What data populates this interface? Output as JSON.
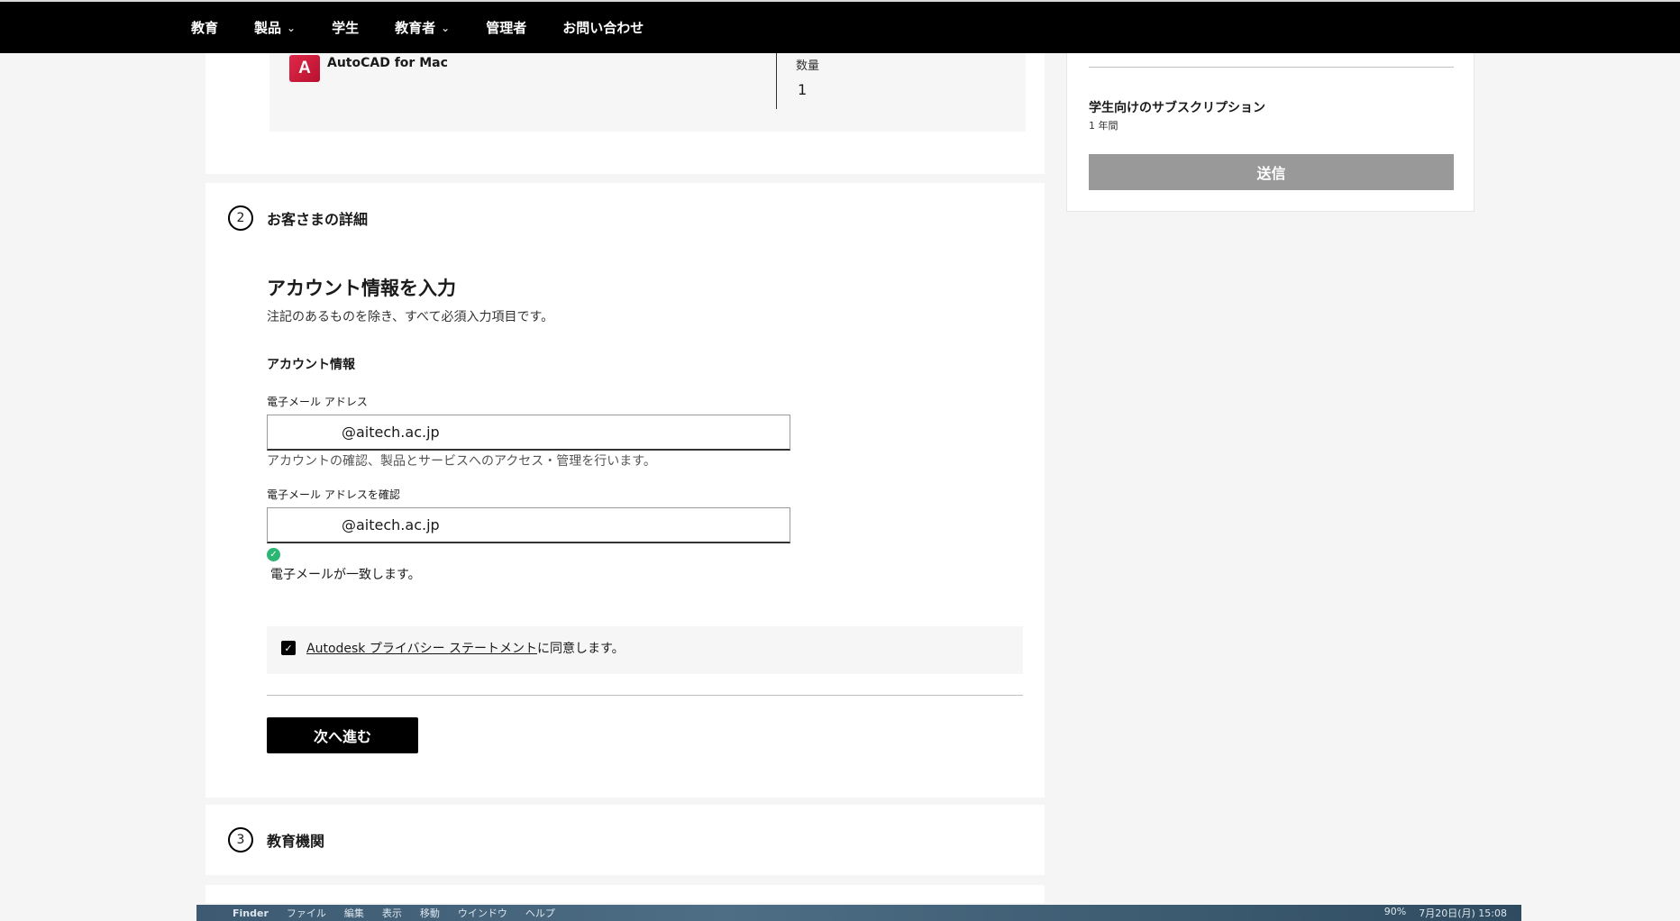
{
  "nav": {
    "items": [
      {
        "label": "教育",
        "has_dropdown": false
      },
      {
        "label": "製品",
        "has_dropdown": true
      },
      {
        "label": "学生",
        "has_dropdown": false
      },
      {
        "label": "教育者",
        "has_dropdown": true
      },
      {
        "label": "管理者",
        "has_dropdown": false
      },
      {
        "label": "お問い合わせ",
        "has_dropdown": false
      }
    ],
    "chevron": "⌄"
  },
  "product": {
    "logo_letter": "A",
    "name": "AutoCAD for Mac",
    "quantity_label": "数量",
    "quantity_value": "1"
  },
  "summary": {
    "title": "学生向けのサブスクリプション",
    "term": "1 年間",
    "submit_label": "送信"
  },
  "step2": {
    "number": "2",
    "title": "お客さまの詳細",
    "heading": "アカウント情報を入力",
    "note": "注記のあるものを除き、すべて必須入力項目です。",
    "section_title": "アカウント情報",
    "email_label": "電子メール アドレス",
    "email_value": "@aitech.ac.jp",
    "email_helper": "アカウントの確認、製品とサービスへのアクセス・管理を行います。",
    "confirm_label": "電子メール アドレスを確認",
    "confirm_value": "@aitech.ac.jp",
    "match_message": "電子メールが一致します。",
    "consent_link": "Autodesk プライバシー ステートメント",
    "consent_suffix": "に同意します。",
    "next_label": "次へ進む"
  },
  "step3": {
    "number": "3",
    "title": "教育機関"
  },
  "menubar": {
    "apple": "",
    "app": "Finder",
    "menus": [
      "ファイル",
      "編集",
      "表示",
      "移動",
      "ウインドウ",
      "ヘルプ"
    ],
    "battery": "90%",
    "clock": "7月20日(月) 15:08"
  }
}
